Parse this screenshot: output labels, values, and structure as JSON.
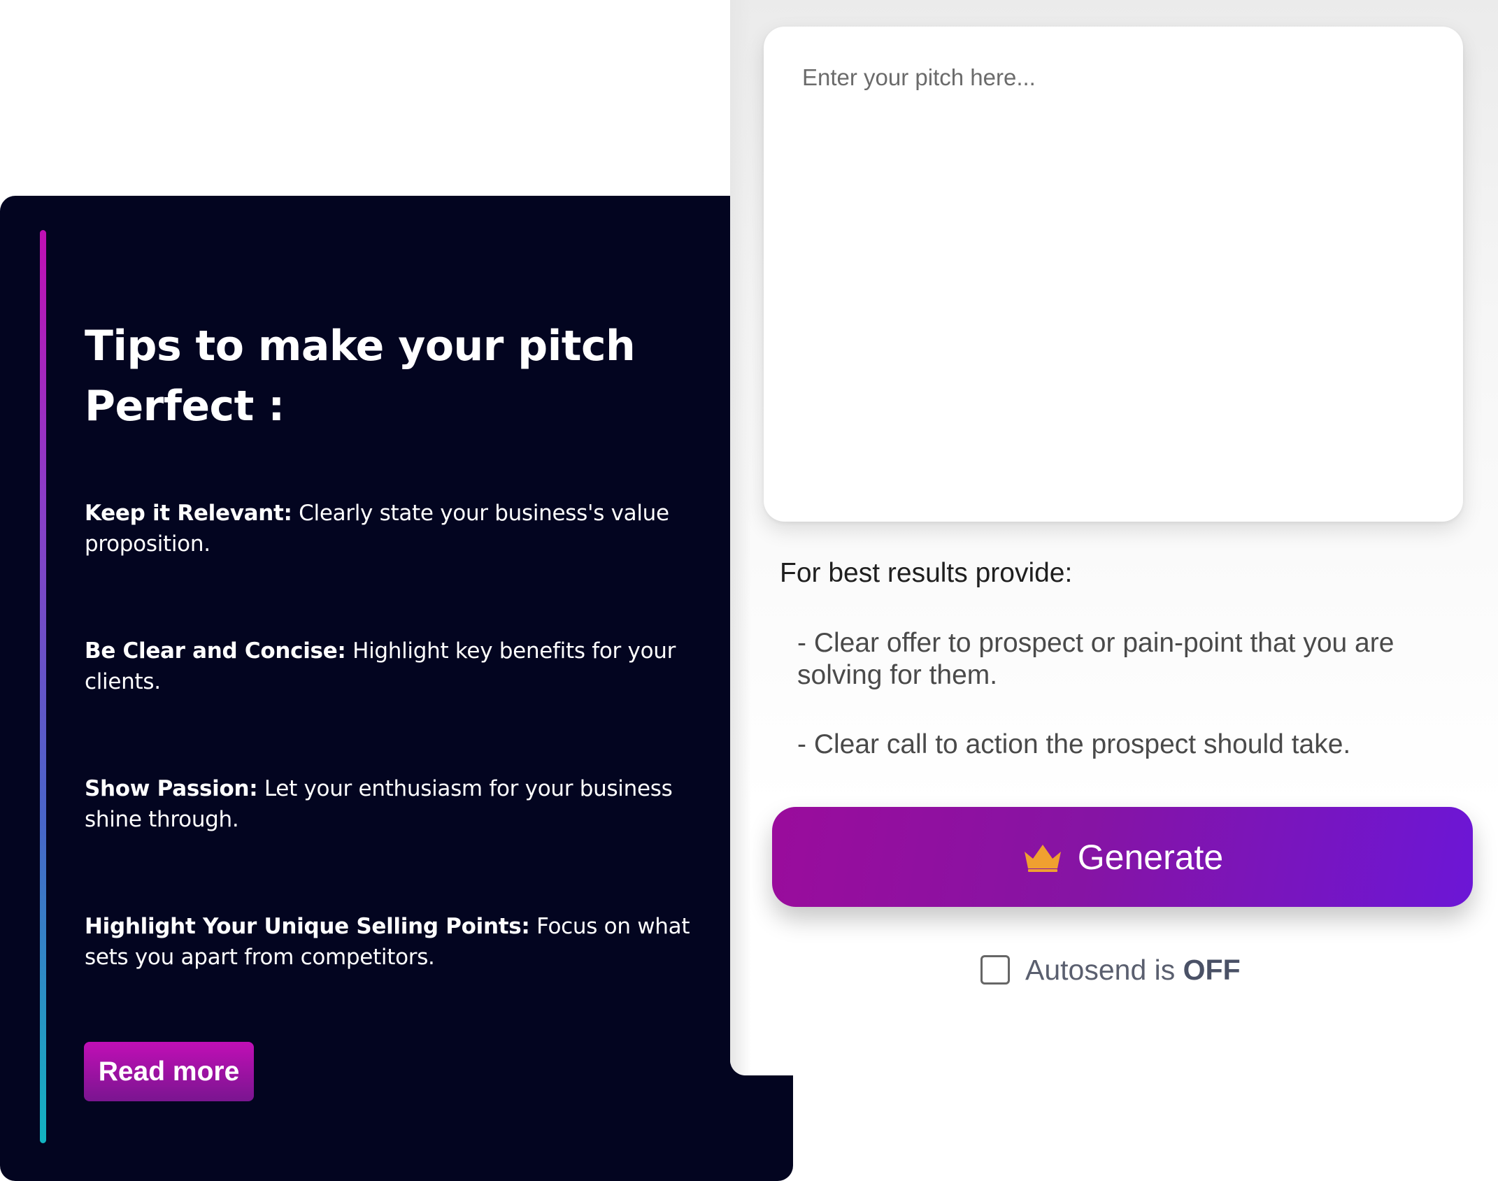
{
  "tips_card": {
    "title": "Tips to make your pitch Perfect :",
    "tips": [
      {
        "heading": "Keep it Relevant:",
        "text": " Clearly state your business's value proposition."
      },
      {
        "heading": "Be Clear and Concise:",
        "text": " Highlight key benefits for your clients."
      },
      {
        "heading": "Show Passion:",
        "text": " Let your enthusiasm for your business shine through."
      },
      {
        "heading": "Highlight Your Unique Selling Points:",
        "text": " Focus on what sets you apart from competitors."
      }
    ],
    "read_more_label": "Read more"
  },
  "form": {
    "pitch_placeholder": "Enter your pitch here...",
    "pitch_value": "",
    "best_results_label": "For best results provide:",
    "hints": [
      "- Clear offer to prospect or pain-point that you are solving for them.",
      "- Clear call to action the prospect should take."
    ],
    "generate_label": "Generate",
    "generate_icon": "crown-icon",
    "autosend_prefix": "Autosend is ",
    "autosend_state": "OFF",
    "autosend_checked": false
  },
  "colors": {
    "tips_background": "#030520",
    "read_more_button": "#b30fab",
    "generate_button_start": "#9a0c9c",
    "generate_button_end": "#6c16d6",
    "crown": "#f0a030"
  }
}
